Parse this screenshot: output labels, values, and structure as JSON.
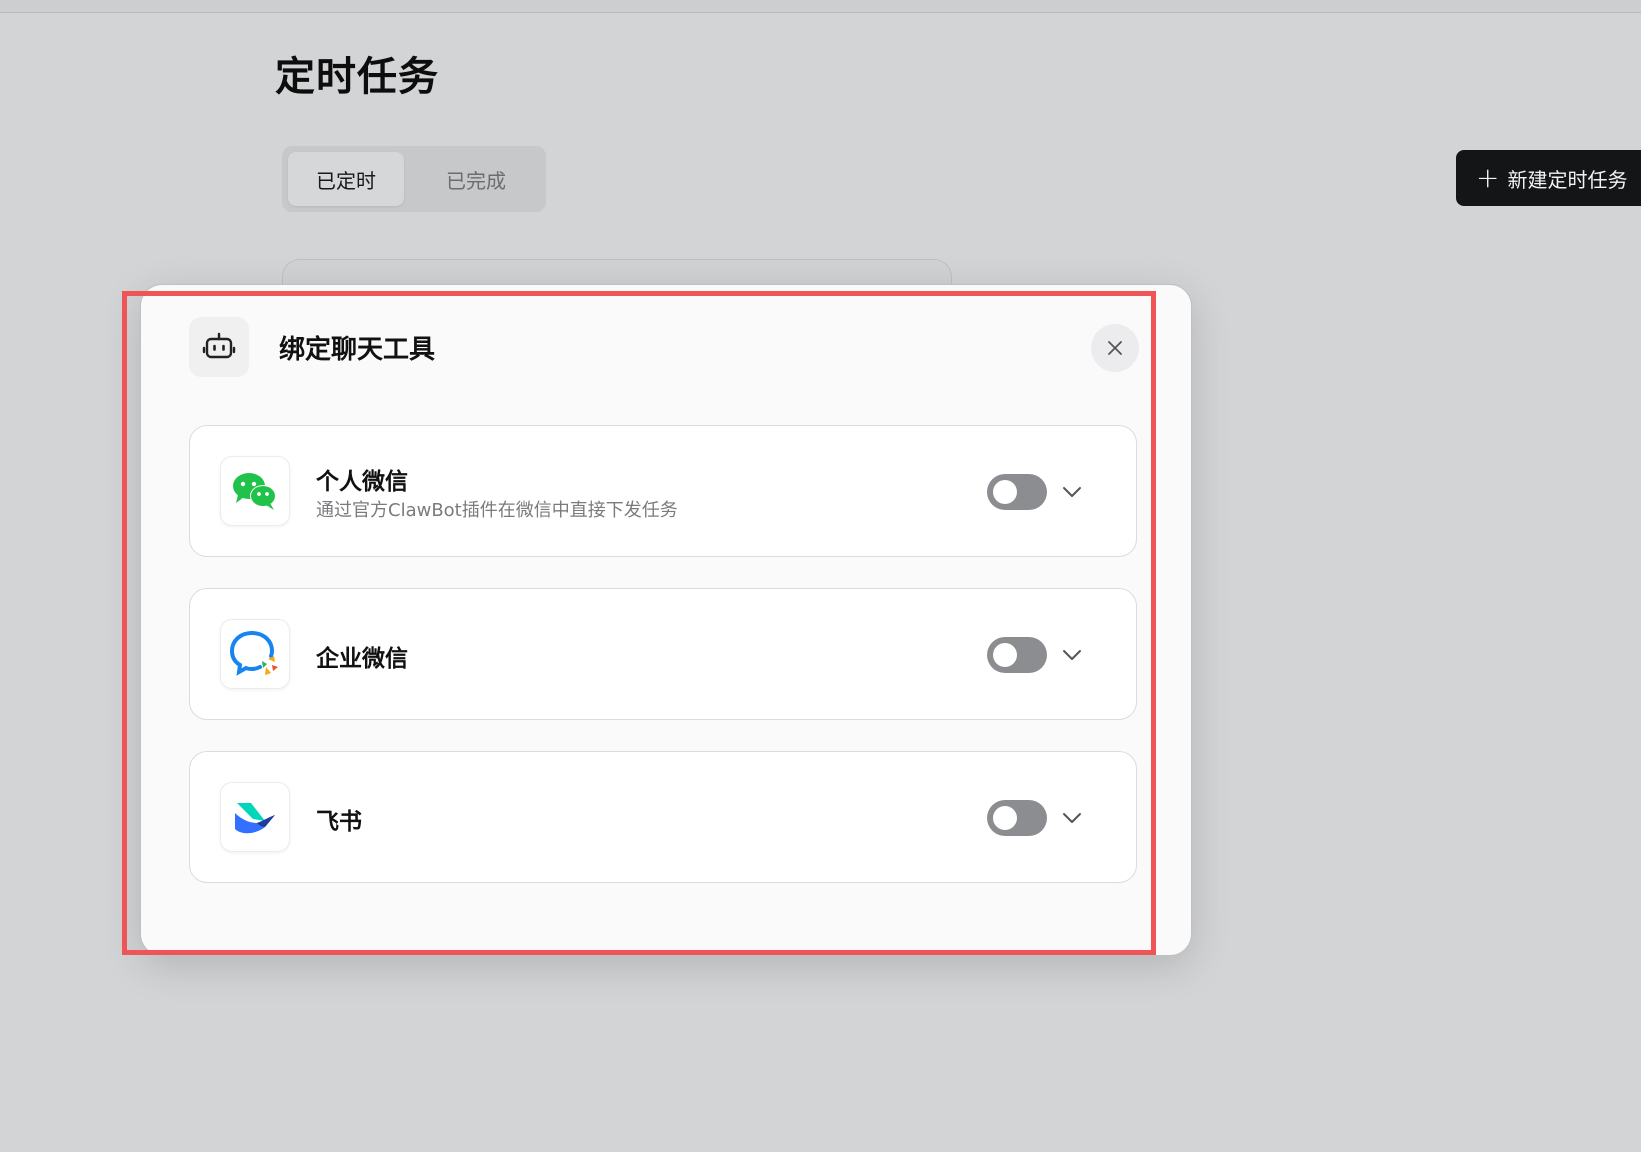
{
  "page": {
    "title": "定时任务",
    "tabs": [
      {
        "label": "已定时",
        "active": true
      },
      {
        "label": "已完成",
        "active": false
      }
    ],
    "new_task_button": {
      "icon": "plus-icon",
      "label": "新建定时任务"
    }
  },
  "modal": {
    "icon": "robot-icon",
    "title": "绑定聊天工具",
    "close_icon": "close-icon",
    "channels": [
      {
        "name": "个人微信",
        "description": "通过官方ClawBot插件在微信中直接下发任务",
        "icon": "wechat-icon",
        "enabled": false
      },
      {
        "name": "企业微信",
        "description": "",
        "icon": "wecom-icon",
        "enabled": false
      },
      {
        "name": "飞书",
        "description": "",
        "icon": "feishu-icon",
        "enabled": false
      }
    ]
  },
  "colors": {
    "background": "#d3d4d6",
    "modal_background": "#fafafa",
    "highlight_border": "#ef5556",
    "primary_button": "#141517",
    "toggle_off": "#8c8d90",
    "wechat_green": "#21c24a",
    "wecom_blue": "#1685f0",
    "feishu_blue": "#3370ff"
  }
}
